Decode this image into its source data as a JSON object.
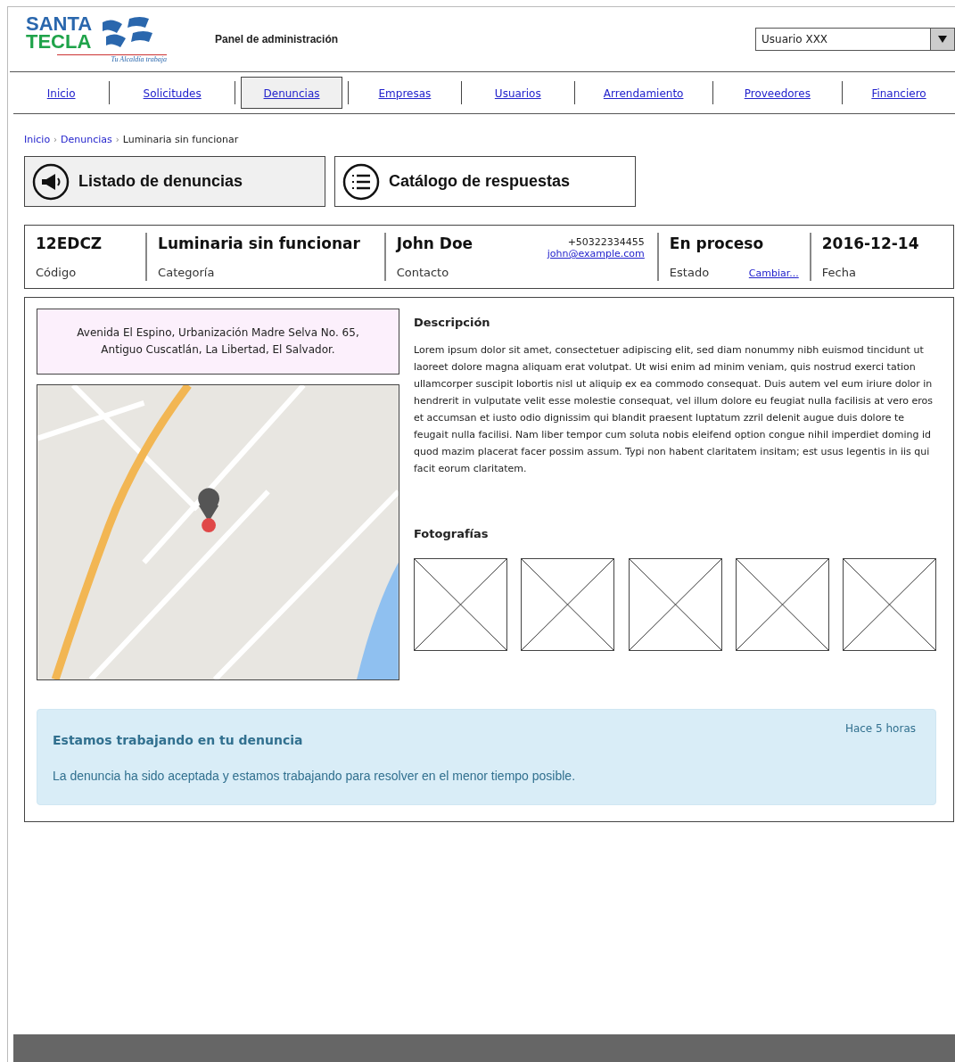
{
  "header": {
    "logo": {
      "line_1": "SANTA",
      "line_2": "TECLA",
      "tagline": "Tu Alcaldía trabaja"
    },
    "title": "Panel de administración",
    "user_select": {
      "value": "Usuario XXX"
    }
  },
  "nav": [
    {
      "label": "Inicio",
      "selected": false
    },
    {
      "label": "Solicitudes",
      "selected": false
    },
    {
      "label": "Denuncias",
      "selected": true
    },
    {
      "label": "Empresas",
      "selected": false
    },
    {
      "label": "Usuarios",
      "selected": false
    },
    {
      "label": "Arrendamiento",
      "selected": false
    },
    {
      "label": "Proveedores",
      "selected": false
    },
    {
      "label": "Financiero",
      "selected": false
    }
  ],
  "breadcrumb": [
    {
      "label": "Inicio",
      "kind": "link"
    },
    {
      "label": "Denuncias",
      "kind": "link"
    },
    {
      "label": "Luminaria sin funcionar",
      "kind": "current"
    }
  ],
  "breadcrumb_separator": "›",
  "actions": [
    {
      "label": "Listado de denuncias",
      "kind": "megaphone",
      "selected": true
    },
    {
      "label": "Catálogo de respuestas",
      "kind": "list",
      "selected": false
    }
  ],
  "summary": [
    {
      "value": "12EDCZ",
      "label": "Código"
    },
    {
      "value": "Luminaria sin funcionar",
      "label": "Categoría"
    },
    {
      "value": "John Doe",
      "label": "Contacto",
      "phone": "+50322334455",
      "email": "john@example.com"
    },
    {
      "value": "En proceso",
      "label": "Estado",
      "link": "Cambiar..."
    },
    {
      "value": "2016-12-14",
      "label": "Fecha"
    }
  ],
  "address": "Avenida El Espino, Urbanización Madre Selva No. 65, Antiguo Cuscatlán, La Libertad, El Salvador.",
  "description": {
    "title": "Descripción",
    "text": "Lorem ipsum dolor sit amet, consectetuer adipiscing elit, sed diam nonummy nibh euismod tincidunt ut laoreet dolore magna aliquam erat volutpat. Ut wisi enim ad minim veniam, quis nostrud exerci tation ullamcorper suscipit lobortis nisl ut aliquip ex ea commodo consequat. Duis autem vel eum iriure dolor in hendrerit in vulputate velit esse molestie consequat, vel illum dolore eu feugiat nulla facilisis at vero eros et accumsan et iusto odio dignissim qui blandit praesent luptatum zzril delenit augue duis dolore te feugait nulla facilisi. Nam liber tempor cum soluta nobis eleifend option congue nihil imperdiet doming id quod mazim placerat facer possim assum. Typi non habent claritatem insitam; est usus legentis in iis qui facit eorum claritatem."
  },
  "photos": {
    "title": "Fotografías",
    "items": [
      {
        "kind": "placeholder"
      },
      {
        "kind": "placeholder"
      },
      {
        "kind": "placeholder"
      },
      {
        "kind": "placeholder"
      },
      {
        "kind": "placeholder"
      }
    ]
  },
  "alert": {
    "title": "Estamos trabajando en tu denuncia",
    "time": "Hace 5 horas",
    "message": "La denuncia ha sido aceptada y estamos trabajando para resolver en el menor tiempo posible."
  }
}
